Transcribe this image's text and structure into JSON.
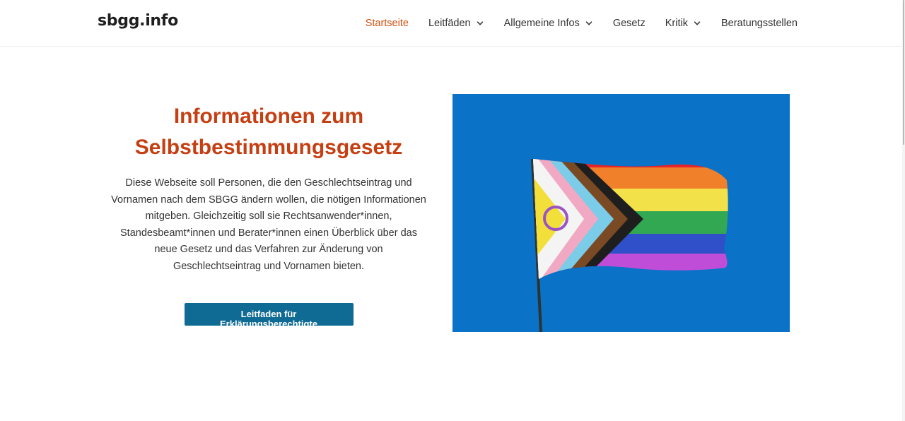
{
  "header": {
    "logo": "sbgg.info",
    "nav": [
      {
        "label": "Startseite",
        "active": true,
        "has_dropdown": false
      },
      {
        "label": "Leitfäden",
        "active": false,
        "has_dropdown": true
      },
      {
        "label": "Allgemeine Infos",
        "active": false,
        "has_dropdown": true
      },
      {
        "label": "Gesetz",
        "active": false,
        "has_dropdown": false
      },
      {
        "label": "Kritik",
        "active": false,
        "has_dropdown": true
      },
      {
        "label": "Beratungsstellen",
        "active": false,
        "has_dropdown": false
      }
    ]
  },
  "hero": {
    "title_line1": "Informationen zum",
    "title_line2": "Selbstbestimmungsgesetz",
    "text_lines": [
      "Diese Webseite soll Personen, die den Geschlechtseintrag und",
      "Vornamen nach dem SBGG ändern wollen, die nötigen Informationen",
      "mitgeben. Gleichzeitig soll sie Rechtsanwender*innen,",
      "Standesbeamt*innen und Berater*innen einen Überblick über das",
      "neue Gesetz und das Verfahren zur Änderung von",
      "Geschlechtseintrag und Vornamen bieten."
    ],
    "cta_label": "Leitfaden für Erklärungsberechtigte",
    "image_icon": "intersex-inclusive-progress-pride-flag-image"
  },
  "colors": {
    "accent": "#d0500f",
    "title": "#c53f12",
    "button": "#0f6a94",
    "sky": "#0a72c7"
  }
}
